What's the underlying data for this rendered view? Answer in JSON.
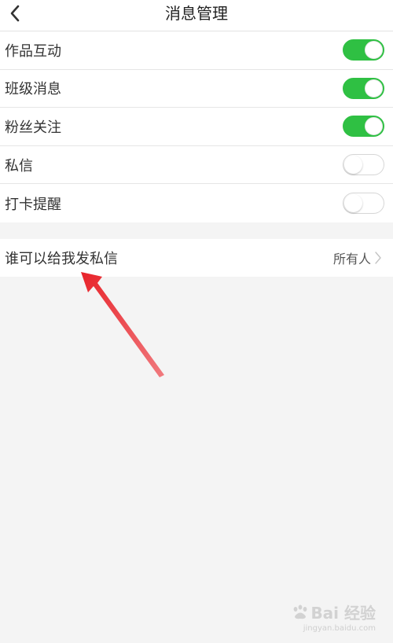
{
  "header": {
    "title": "消息管理",
    "back_icon": "chevron-left-icon"
  },
  "settings": {
    "items": [
      {
        "label": "作品互动",
        "enabled": true
      },
      {
        "label": "班级消息",
        "enabled": true
      },
      {
        "label": "粉丝关注",
        "enabled": true
      },
      {
        "label": "私信",
        "enabled": false
      },
      {
        "label": "打卡提醒",
        "enabled": false
      }
    ]
  },
  "dm_permission": {
    "label": "谁可以给我发私信",
    "value": "所有人",
    "chevron_icon": "chevron-right-icon"
  },
  "annotation": {
    "icon": "red-arrow-icon",
    "color": "#e8232a"
  },
  "watermark": {
    "brand": "Bai 经验",
    "url": "jingyan.baidu.com"
  },
  "colors": {
    "toggle_on": "#2fc043",
    "background": "#f4f4f4"
  }
}
